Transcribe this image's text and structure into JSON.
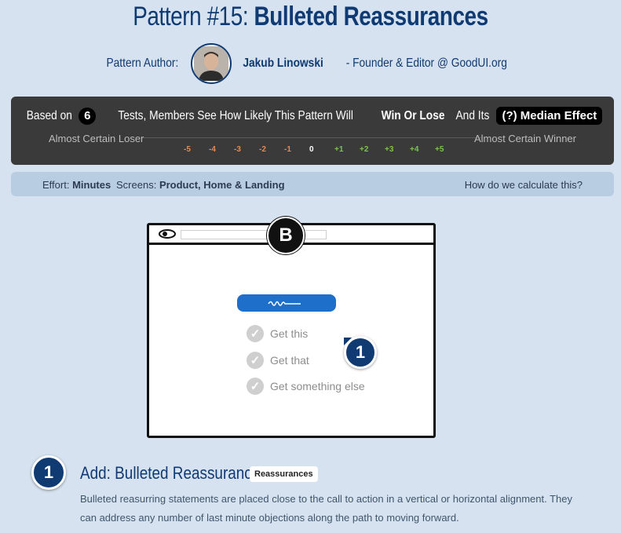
{
  "header": {
    "title_prefix": "Pattern #15: ",
    "title_bold": "Bulleted Reassurances"
  },
  "author": {
    "label": "Pattern Author:",
    "name": "Jakub Linowski",
    "role": "- Founder & Editor @ GoodUI.org"
  },
  "effect_panel": {
    "head_pre": "Based on",
    "tests_count": "6",
    "head_mid": "Tests, Members See How Likely This Pattern Will",
    "head_bold": "Win Or Lose",
    "head_post": "And Its",
    "median_badge": "(?) Median Effect",
    "left_label": "Almost Certain Loser",
    "right_label": "Almost Certain Winner",
    "ticks": [
      "-5",
      "-4",
      "-3",
      "-2",
      "-1",
      "0",
      "+1",
      "+2",
      "+3",
      "+4",
      "+5"
    ],
    "colors": {
      "negative": "#e8894f",
      "zero": "#ffffff",
      "positive": "#7cc44a"
    }
  },
  "meta": {
    "effort_label": "Effort:",
    "effort_value": "Minutes",
    "screens_label": "Screens:",
    "screens_value": "Product, Home & Landing",
    "how_link": "How do we calculate this?"
  },
  "mockup": {
    "variant_badge": "B",
    "items": [
      "Get this",
      "Get that",
      "Get something else"
    ],
    "marker": "1",
    "cta_color": "#1d6fc9"
  },
  "section": {
    "number": "1",
    "title": "Add: Bulleted Reassurances",
    "tag": "Reassurances",
    "description": "Bulleted reasurring statements are placed close to the call to action in a vertical or horizontal alignment. They can address any number of last minute objections along the path to moving forward."
  }
}
